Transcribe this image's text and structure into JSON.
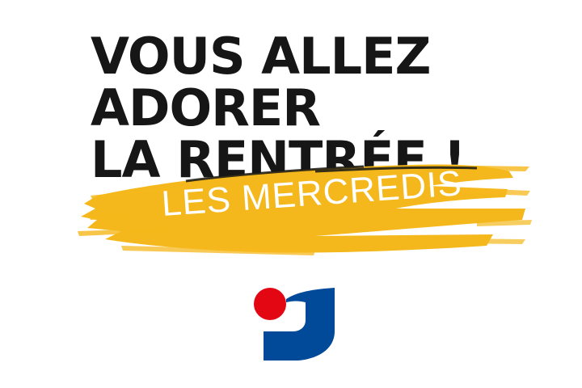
{
  "headline": {
    "line1": "VOUS ALLEZ",
    "line2": "ADORER",
    "line3": "LA RENTRÉE !"
  },
  "banner": {
    "text": "LES MERCREDIS",
    "brush_color": "#f5b81c",
    "text_color": "#ffffff"
  },
  "logo": {
    "icon": "intermarche-logo-icon",
    "dot_color": "#e30613",
    "shape_color": "#004a99"
  },
  "colors": {
    "background": "#ffffff",
    "headline": "#161616"
  }
}
